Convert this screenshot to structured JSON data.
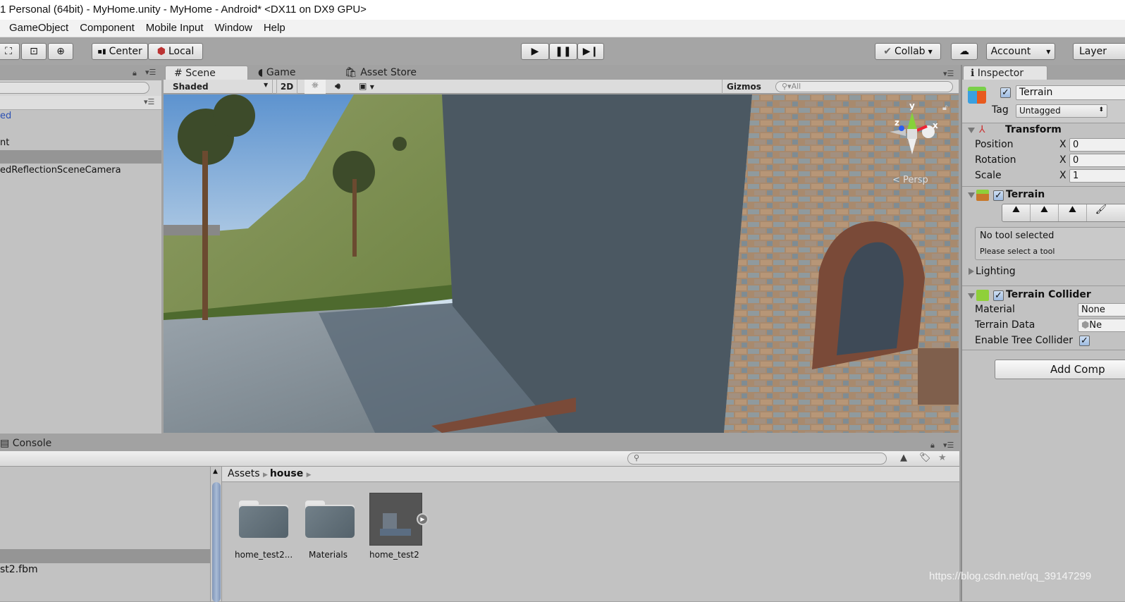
{
  "window_title": "1 Personal (64bit) - MyHome.unity - MyHome - Android* <DX11 on DX9 GPU>",
  "menu": [
    "GameObject",
    "Component",
    "Mobile Input",
    "Window",
    "Help"
  ],
  "toolbar": {
    "pivot": "Center",
    "space": "Local",
    "collab": "Collab",
    "account": "Account",
    "layers": "Layer",
    "play_icons": [
      "play-icon",
      "pause-icon",
      "step-icon"
    ]
  },
  "hierarchy": {
    "items": [
      "ed",
      "",
      "nt",
      "",
      "edReflectionSceneCamera"
    ],
    "selected_index": 3
  },
  "scene": {
    "tabs": [
      "Scene",
      "Game",
      "Asset Store"
    ],
    "active_tab": "Scene",
    "shading": "Shaded",
    "mode_2d": "2D",
    "gizmos": "Gizmos",
    "search_placeholder": "All",
    "gizmo_axes": {
      "x": "x",
      "y": "y",
      "z": "z"
    },
    "projection": "< Persp",
    "colors": {
      "sky": "#9ec4e4",
      "grass": "#7a8f4a",
      "wall": "#4a5660",
      "brick": "#a98a6c",
      "floor": "#8d98a1"
    }
  },
  "inspector": {
    "tab": "Inspector",
    "object_name": "Terrain",
    "active": true,
    "tag_label": "Tag",
    "tag_value": "Untagged",
    "transform": {
      "title": "Transform",
      "rows": [
        {
          "label": "Position",
          "axis": "X",
          "value": "0"
        },
        {
          "label": "Rotation",
          "axis": "X",
          "value": "0"
        },
        {
          "label": "Scale",
          "axis": "X",
          "value": "1"
        }
      ]
    },
    "terrain": {
      "title": "Terrain",
      "enabled": true,
      "help_title": "No tool selected",
      "help_text": "Please select a tool",
      "lighting": "Lighting"
    },
    "collider": {
      "title": "Terrain Collider",
      "enabled": true,
      "material_label": "Material",
      "material_value": "None",
      "data_label": "Terrain Data",
      "data_value": "Ne",
      "tree_label": "Enable Tree Collider",
      "tree_checked": true
    },
    "add_component": "Add Comp"
  },
  "bottom": {
    "console_tab": "Console",
    "tree_items": [
      "",
      "st2.fbm"
    ],
    "breadcrumb": [
      "Assets",
      "house"
    ],
    "assets": [
      {
        "name": "home_test2...",
        "type": "folder"
      },
      {
        "name": "Materials",
        "type": "folder"
      },
      {
        "name": "home_test2",
        "type": "model"
      }
    ]
  },
  "watermark": "https://blog.csdn.net/qq_39147299"
}
